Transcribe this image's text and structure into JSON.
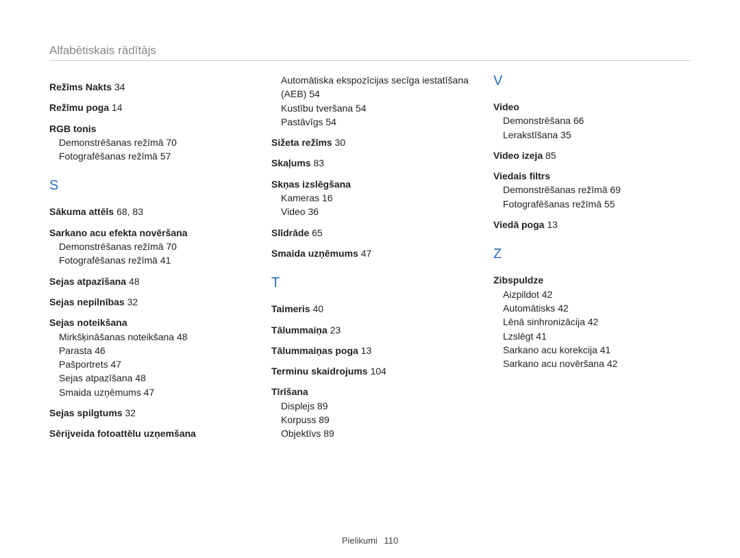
{
  "page_title": "Alfabētiskais rādītājs",
  "footer": {
    "label": "Pielikumi",
    "page": "110"
  },
  "col1": {
    "e1": {
      "t": "Režīms Nakts",
      "p": "34"
    },
    "e2": {
      "t": "Režīmu poga",
      "p": "14"
    },
    "e3": {
      "t": "RGB tonis"
    },
    "e3s1": "Demonstrēšanas režīmā  70",
    "e3s2": "Fotografēšanas režīmā  57",
    "letterS": "S",
    "e4": {
      "t": "Sākuma attēls",
      "p": "68, 83"
    },
    "e5": {
      "t": "Sarkano acu efekta novēršana"
    },
    "e5s1": "Demonstrēšanas režīmā  70",
    "e5s2": "Fotografēšanas režīmā  41",
    "e6": {
      "t": "Sejas atpazīšana",
      "p": "48"
    },
    "e7": {
      "t": "Sejas nepilnības",
      "p": "32"
    },
    "e8": {
      "t": "Sejas noteikšana"
    },
    "e8s1": "Mirkšķināšanas noteikšana  48",
    "e8s2": "Parasta  46",
    "e8s3": "Pašportrets  47",
    "e8s4": "Sejas atpazīšana  48",
    "e8s5": "Smaida uzņēmums  47",
    "e9": {
      "t": "Sejas spilgtums",
      "p": "32"
    },
    "e10": {
      "t": "Sērijveida fotoattēlu uzņemšana"
    }
  },
  "col2": {
    "e1s1": "Automātiska ekspozīcijas secīga iestatīšana (AEB)  54",
    "e1s2": "Kustību tveršana  54",
    "e1s3": "Pastāvīgs  54",
    "e2": {
      "t": "Sižeta režīms",
      "p": "30"
    },
    "e3": {
      "t": "Skaļums",
      "p": "83"
    },
    "e4": {
      "t": "Skņas izslēgšana"
    },
    "e4s1": "Kameras  16",
    "e4s2": "Video  36",
    "e5": {
      "t": "Slīdrāde",
      "p": "65"
    },
    "e6": {
      "t": "Smaida uzņēmums",
      "p": "47"
    },
    "letterT": "T",
    "e7": {
      "t": "Taimeris",
      "p": "40"
    },
    "e8": {
      "t": "Tālummaiņa",
      "p": "23"
    },
    "e9": {
      "t": "Tālummaiņas poga",
      "p": "13"
    },
    "e10": {
      "t": "Terminu skaidrojums",
      "p": "104"
    },
    "e11": {
      "t": "Tīrīšana"
    },
    "e11s1": "Displejs  89",
    "e11s2": "Korpuss  89",
    "e11s3": "Objektīvs  89"
  },
  "col3": {
    "letterV": "V",
    "e1": {
      "t": "Video"
    },
    "e1s1": "Demonstrēšana  66",
    "e1s2": "Lerakstīšana  35",
    "e2": {
      "t": "Video izeja",
      "p": "85"
    },
    "e3": {
      "t": "Viedais filtrs"
    },
    "e3s1": "Demonstrēšanas režīmā  69",
    "e3s2": "Fotografēšanas režīmā  55",
    "e4": {
      "t": "Viedā poga",
      "p": "13"
    },
    "letterZ": "Z",
    "e5": {
      "t": "Zibspuldze"
    },
    "e5s1": "Aizpildot  42",
    "e5s2": "Automātisks  42",
    "e5s3": "Lēnā sinhronizācija  42",
    "e5s4": "Lzslēgt  41",
    "e5s5": "Sarkano acu korekcija  41",
    "e5s6": "Sarkano acu novēršana  42"
  }
}
